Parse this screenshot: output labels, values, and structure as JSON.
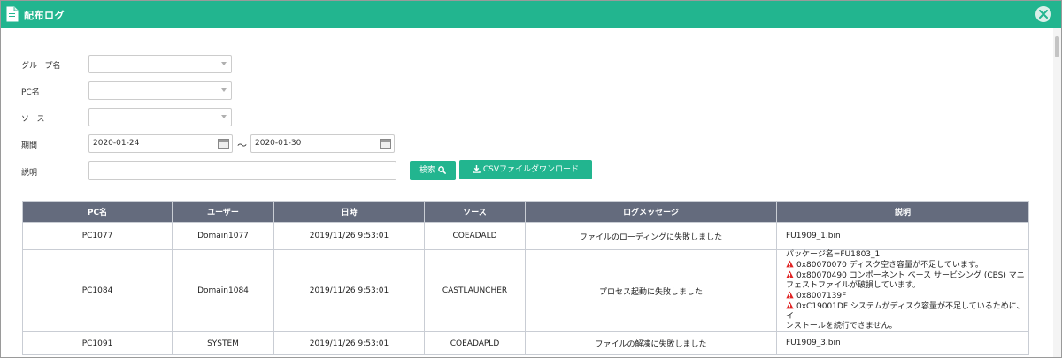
{
  "window": {
    "title": "配布ログ"
  },
  "form": {
    "group_label": "グループ名",
    "pc_label": "PC名",
    "source_label": "ソース",
    "period_label": "期間",
    "date_from": "2020-01-24",
    "date_separator": "～",
    "date_to": "2020-01-30",
    "desc_label": "説明",
    "search_label": "検索",
    "csv_label": "CSVファイルダウンロード"
  },
  "table": {
    "headers": [
      "PC名",
      "ユーザー",
      "日時",
      "ソース",
      "ログメッセージ",
      "説明"
    ],
    "rows": [
      {
        "pc": "PC1077",
        "user": "Domain1077",
        "datetime": "2019/11/26 9:53:01",
        "source": "COEADALD",
        "message": "ファイルのローディングに失敗しました",
        "desc": "FU1909_1.bin"
      },
      {
        "pc": "PC1084",
        "user": "Domain1084",
        "datetime": "2019/11/26 9:53:01",
        "source": "CASTLAUNCHER",
        "message": "プロセス起動に失敗しました",
        "desc_lines": [
          "パッケージ名=FU1803_1",
          "0x80070070 ディスク空き容量が不足しています。",
          "0x80070490 コンポーネント ベース サービシング (CBS) マニ",
          "フェストファイルが破損しています。",
          "0x8007139F",
          "0xC19001DF システムがディスク容量が不足しているために、イ",
          "ンストールを続行できません。"
        ]
      },
      {
        "pc": "PC1091",
        "user": "SYSTEM",
        "datetime": "2019/11/26 9:53:01",
        "source": "COEADAPLD",
        "message": "ファイルの解凍に失敗しました",
        "desc": "FU1909_3.bin"
      }
    ]
  },
  "colors": {
    "accent": "#22b58f",
    "header_bg": "#646b7d",
    "warning": "#e02424"
  },
  "icons": [
    "document-icon",
    "close-icon",
    "calendar-icon",
    "search-icon",
    "download-icon",
    "warning-icon"
  ]
}
